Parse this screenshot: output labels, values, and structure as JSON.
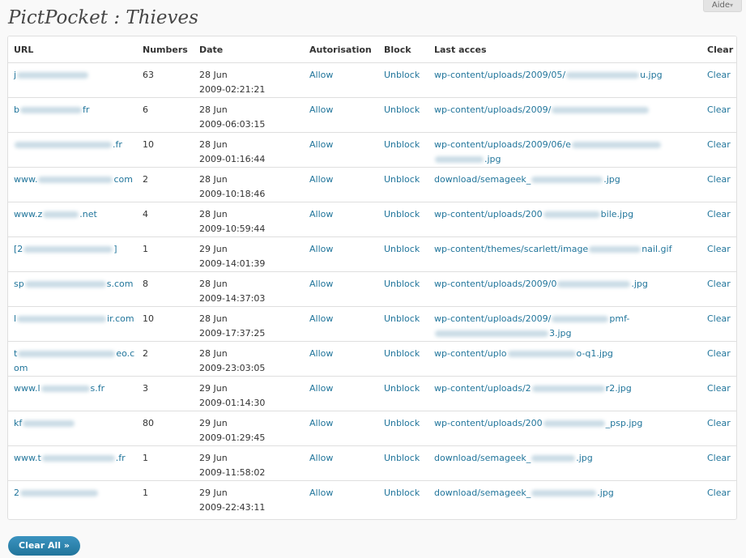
{
  "header": {
    "help_label": "Aide",
    "help_arrow": "▾",
    "title": "PictPocket : Thieves"
  },
  "table": {
    "columns": {
      "url": "URL",
      "numbers": "Numbers",
      "date": "Date",
      "autorisation": "Autorisation",
      "block": "Block",
      "last": "Last acces",
      "clear": "Clear"
    },
    "rows": [
      {
        "url_pre": "j",
        "url_post": "",
        "number": "63",
        "day": "28 Jun",
        "time": "2009-02:21:21",
        "allow": "Allow",
        "unblock": "Unblock",
        "last_pre": "wp-content/uploads/2009/05/",
        "last_post": "u.jpg",
        "last2_pre": "",
        "last2_post": "",
        "clear": "Clear"
      },
      {
        "url_pre": "b",
        "url_post": "fr",
        "number": "6",
        "day": "28 Jun",
        "time": "2009-06:03:15",
        "allow": "Allow",
        "unblock": "Unblock",
        "last_pre": "wp-content/uploads/2009/",
        "last_post": "",
        "last2_pre": "",
        "last2_post": "",
        "clear": "Clear"
      },
      {
        "url_pre": "",
        "url_post": ".fr",
        "number": "10",
        "day": "28 Jun",
        "time": "2009-01:16:44",
        "allow": "Allow",
        "unblock": "Unblock",
        "last_pre": "wp-content/uploads/2009/06/e",
        "last_post": "",
        "last2_pre": "",
        "last2_post": ".jpg",
        "clear": "Clear"
      },
      {
        "url_pre": "www.",
        "url_post": "com",
        "number": "2",
        "day": "28 Jun",
        "time": "2009-10:18:46",
        "allow": "Allow",
        "unblock": "Unblock",
        "last_pre": "download/semageek_",
        "last_post": ".jpg",
        "last2_pre": "",
        "last2_post": "",
        "clear": "Clear"
      },
      {
        "url_pre": "www.z",
        "url_post": ".net",
        "number": "4",
        "day": "28 Jun",
        "time": "2009-10:59:44",
        "allow": "Allow",
        "unblock": "Unblock",
        "last_pre": "wp-content/uploads/200",
        "last_post": "bile.jpg",
        "last2_pre": "",
        "last2_post": "",
        "clear": "Clear"
      },
      {
        "url_pre": "[2",
        "url_post": "]",
        "number": "1",
        "day": "29 Jun",
        "time": "2009-14:01:39",
        "allow": "Allow",
        "unblock": "Unblock",
        "last_pre": "wp-content/themes/scarlett/image",
        "last_post": "nail.gif",
        "last2_pre": "",
        "last2_post": "",
        "clear": "Clear"
      },
      {
        "url_pre": "sp",
        "url_post": "s.com",
        "number": "8",
        "day": "28 Jun",
        "time": "2009-14:37:03",
        "allow": "Allow",
        "unblock": "Unblock",
        "last_pre": "wp-content/uploads/2009/0",
        "last_post": ".jpg",
        "last2_pre": "",
        "last2_post": "",
        "clear": "Clear"
      },
      {
        "url_pre": "l",
        "url_post": "ir.com",
        "number": "10",
        "day": "28 Jun",
        "time": "2009-17:37:25",
        "allow": "Allow",
        "unblock": "Unblock",
        "last_pre": "wp-content/uploads/2009/",
        "last_post": "pmf-",
        "last2_pre": "",
        "last2_post": "3.jpg",
        "clear": "Clear"
      },
      {
        "url_pre": "t",
        "url_post": "eo.com",
        "number": "2",
        "day": "28 Jun",
        "time": "2009-23:03:05",
        "allow": "Allow",
        "unblock": "Unblock",
        "last_pre": "wp-content/uplo",
        "last_post": "o-q1.jpg",
        "last2_pre": "",
        "last2_post": "",
        "clear": "Clear"
      },
      {
        "url_pre": "www.l",
        "url_post": "s.fr",
        "number": "3",
        "day": "29 Jun",
        "time": "2009-01:14:30",
        "allow": "Allow",
        "unblock": "Unblock",
        "last_pre": "wp-content/uploads/2",
        "last_post": "r2.jpg",
        "last2_pre": "",
        "last2_post": "",
        "clear": "Clear"
      },
      {
        "url_pre": "kf",
        "url_post": "",
        "number": "80",
        "day": "29 Jun",
        "time": "2009-01:29:45",
        "allow": "Allow",
        "unblock": "Unblock",
        "last_pre": "wp-content/uploads/200",
        "last_post": "_psp.jpg",
        "last2_pre": "",
        "last2_post": "",
        "clear": "Clear"
      },
      {
        "url_pre": "www.t",
        "url_post": ".fr",
        "number": "1",
        "day": "29 Jun",
        "time": "2009-11:58:02",
        "allow": "Allow",
        "unblock": "Unblock",
        "last_pre": "download/semageek_",
        "last_post": ".jpg",
        "last2_pre": "",
        "last2_post": "",
        "clear": "Clear"
      },
      {
        "url_pre": "2",
        "url_post": "",
        "number": "1",
        "day": "29 Jun",
        "time": "2009-22:43:11",
        "allow": "Allow",
        "unblock": "Unblock",
        "last_pre": "download/semageek_",
        "last_post": ".jpg",
        "last2_pre": "",
        "last2_post": "",
        "clear": "Clear"
      }
    ]
  },
  "footer": {
    "clear_all_label": "Clear All »"
  },
  "colors": {
    "link": "#21759b",
    "button": "#21759b",
    "background": "#f9f9f9",
    "border": "#dfdfdf"
  }
}
